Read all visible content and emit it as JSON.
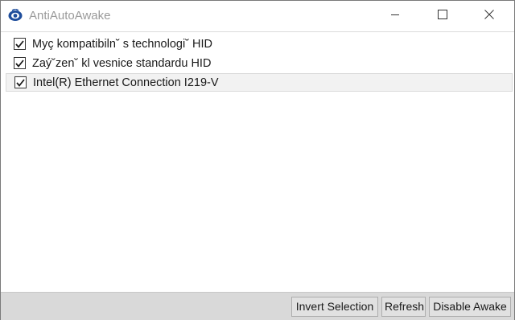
{
  "window": {
    "title": "AntiAutoAwake",
    "icon": "app-icon",
    "controls": [
      "minimize-icon",
      "maximize-icon",
      "close-icon"
    ]
  },
  "devices": [
    {
      "label": "Myç kompatibiln˘ s technologi˘ HID",
      "checked": true,
      "selected": false
    },
    {
      "label": "Zaý˘zen˘ kl vesnice standardu HID",
      "checked": true,
      "selected": false
    },
    {
      "label": "Intel(R) Ethernet Connection I219-V",
      "checked": true,
      "selected": true
    }
  ],
  "buttons": {
    "invert": "Invert Selection",
    "refresh": "Refresh",
    "disable": "Disable Awake"
  }
}
